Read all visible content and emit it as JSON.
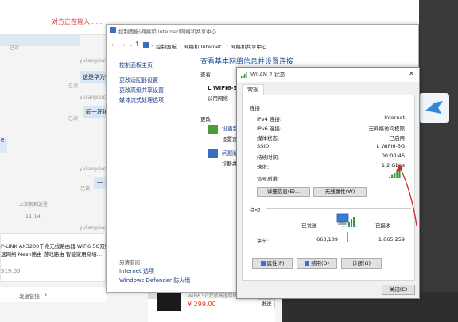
{
  "chat": {
    "typing_status": "对方正在输入......",
    "read_label": "已读",
    "username": "yuliangduc",
    "messages": [
      {
        "text": "这是华为W"
      },
      {
        "text": "同一环境"
      },
      {
        "text": "一"
      }
    ],
    "last_login": "上次解到这里",
    "time": "11:14",
    "product_title": "P-LINK AX3200千兆无线路由器 WiFi6 5G双频",
    "product_desc": "速网络 Mesh路由 游戏路由 智能家用穿墙...",
    "product_price": "319.00",
    "send_link": "发送链接",
    "product2_title": "WiFi6 5G双频高速网络 Mesh路",
    "product2_price": "¥ 299.00",
    "send_button": "发送",
    "left_fragment": "e"
  },
  "control_panel": {
    "window_title": "控制面板\\网络和 Internet\\网络和共享中心",
    "breadcrumb": [
      "控制面板",
      "网络和 Internet",
      "网络和共享中心"
    ],
    "sidebar": {
      "home": "控制面板主页",
      "links": [
        "更改适配器设置",
        "更改高级共享设置",
        "媒体流式处理选项"
      ],
      "see_also_title": "另请参阅",
      "see_also": [
        "Internet 选项",
        "Windows Defender 防火墙"
      ]
    },
    "main_title": "查看基本网络信息并设置连接",
    "active_label": "查看",
    "network_name": "L WIFI6-5G",
    "network_type": "公用网络",
    "change_label": "更改",
    "item1_title": "设置新",
    "item1_desc": "设置宽",
    "item2_title": "问题疑",
    "item2_desc": "诊断并"
  },
  "dialog": {
    "title": "WLAN 2 状态",
    "tab": "常规",
    "connection_header": "连接",
    "rows": [
      {
        "label": "IPv4 连接:",
        "value": "Internet"
      },
      {
        "label": "IPv6 连接:",
        "value": "无网络访问权限"
      },
      {
        "label": "媒体状态:",
        "value": "已启用"
      },
      {
        "label": "SSID:",
        "value": "L WIFI6-5G"
      },
      {
        "label": "持续时间:",
        "value": "00:00:46"
      },
      {
        "label": "速度:",
        "value": "1.2 Gbps"
      }
    ],
    "signal_label": "信号质量:",
    "signal_bars": 5,
    "details_button": "详细信息(E)...",
    "wireless_button": "无线属性(W)",
    "activity_header": "活动",
    "sent_label": "已发送",
    "received_label": "已接收",
    "bytes_label": "字节:",
    "bytes_sent": "663,189",
    "bytes_received": "1,065,259",
    "properties_button": "属性(P)",
    "disable_button": "禁用(D)",
    "diagnose_button": "诊断(G)",
    "close_button": "关闭(C)",
    "close_x": "✕"
  },
  "colors": {
    "annotation_arrow": "#d0262c",
    "link": "#1a3d8a",
    "title_blue": "#1f4e9e"
  }
}
